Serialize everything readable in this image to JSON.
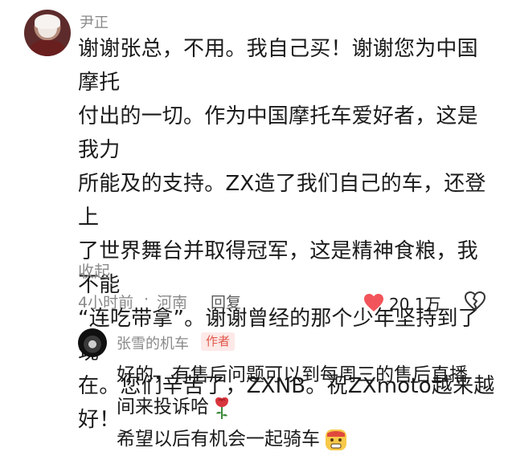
{
  "comment": {
    "username": "尹正",
    "text": "谢谢张总，不用。我自己买！谢谢您为中国摩托\n付出的一切。作为中国摩托车爱好者，这是我力\n所能及的支持。ZX造了我们自己的车，还登上\n了世界舞台并取得冠军，这是精神食粮，我不能\n“连吃带拿”。谢谢曾经的那个少年坚持到了现\n在。您们辛苦了，ZXNB。祝ZXmoto越来越\n好！",
    "collapse_label": "收起",
    "time": "4小时前",
    "separator": "·",
    "location": "河南",
    "reply_label": "回复",
    "like_count": "20.1万"
  },
  "reply": {
    "username": "张雪的机车",
    "badge": "作者",
    "line1": "好的，有售后问题可以到每周三的售后直播",
    "line2": "间来投诉哈",
    "line3": "希望以后有机会一起骑车"
  },
  "icons": {
    "like": "heart-icon",
    "dislike": "broken-heart-icon",
    "rose": "rose-emoji-icon",
    "face": "grimace-emoji-icon"
  },
  "colors": {
    "like_heart": "#f2545b",
    "author_badge": "#e0584c",
    "muted_text": "#8a8a8a"
  }
}
